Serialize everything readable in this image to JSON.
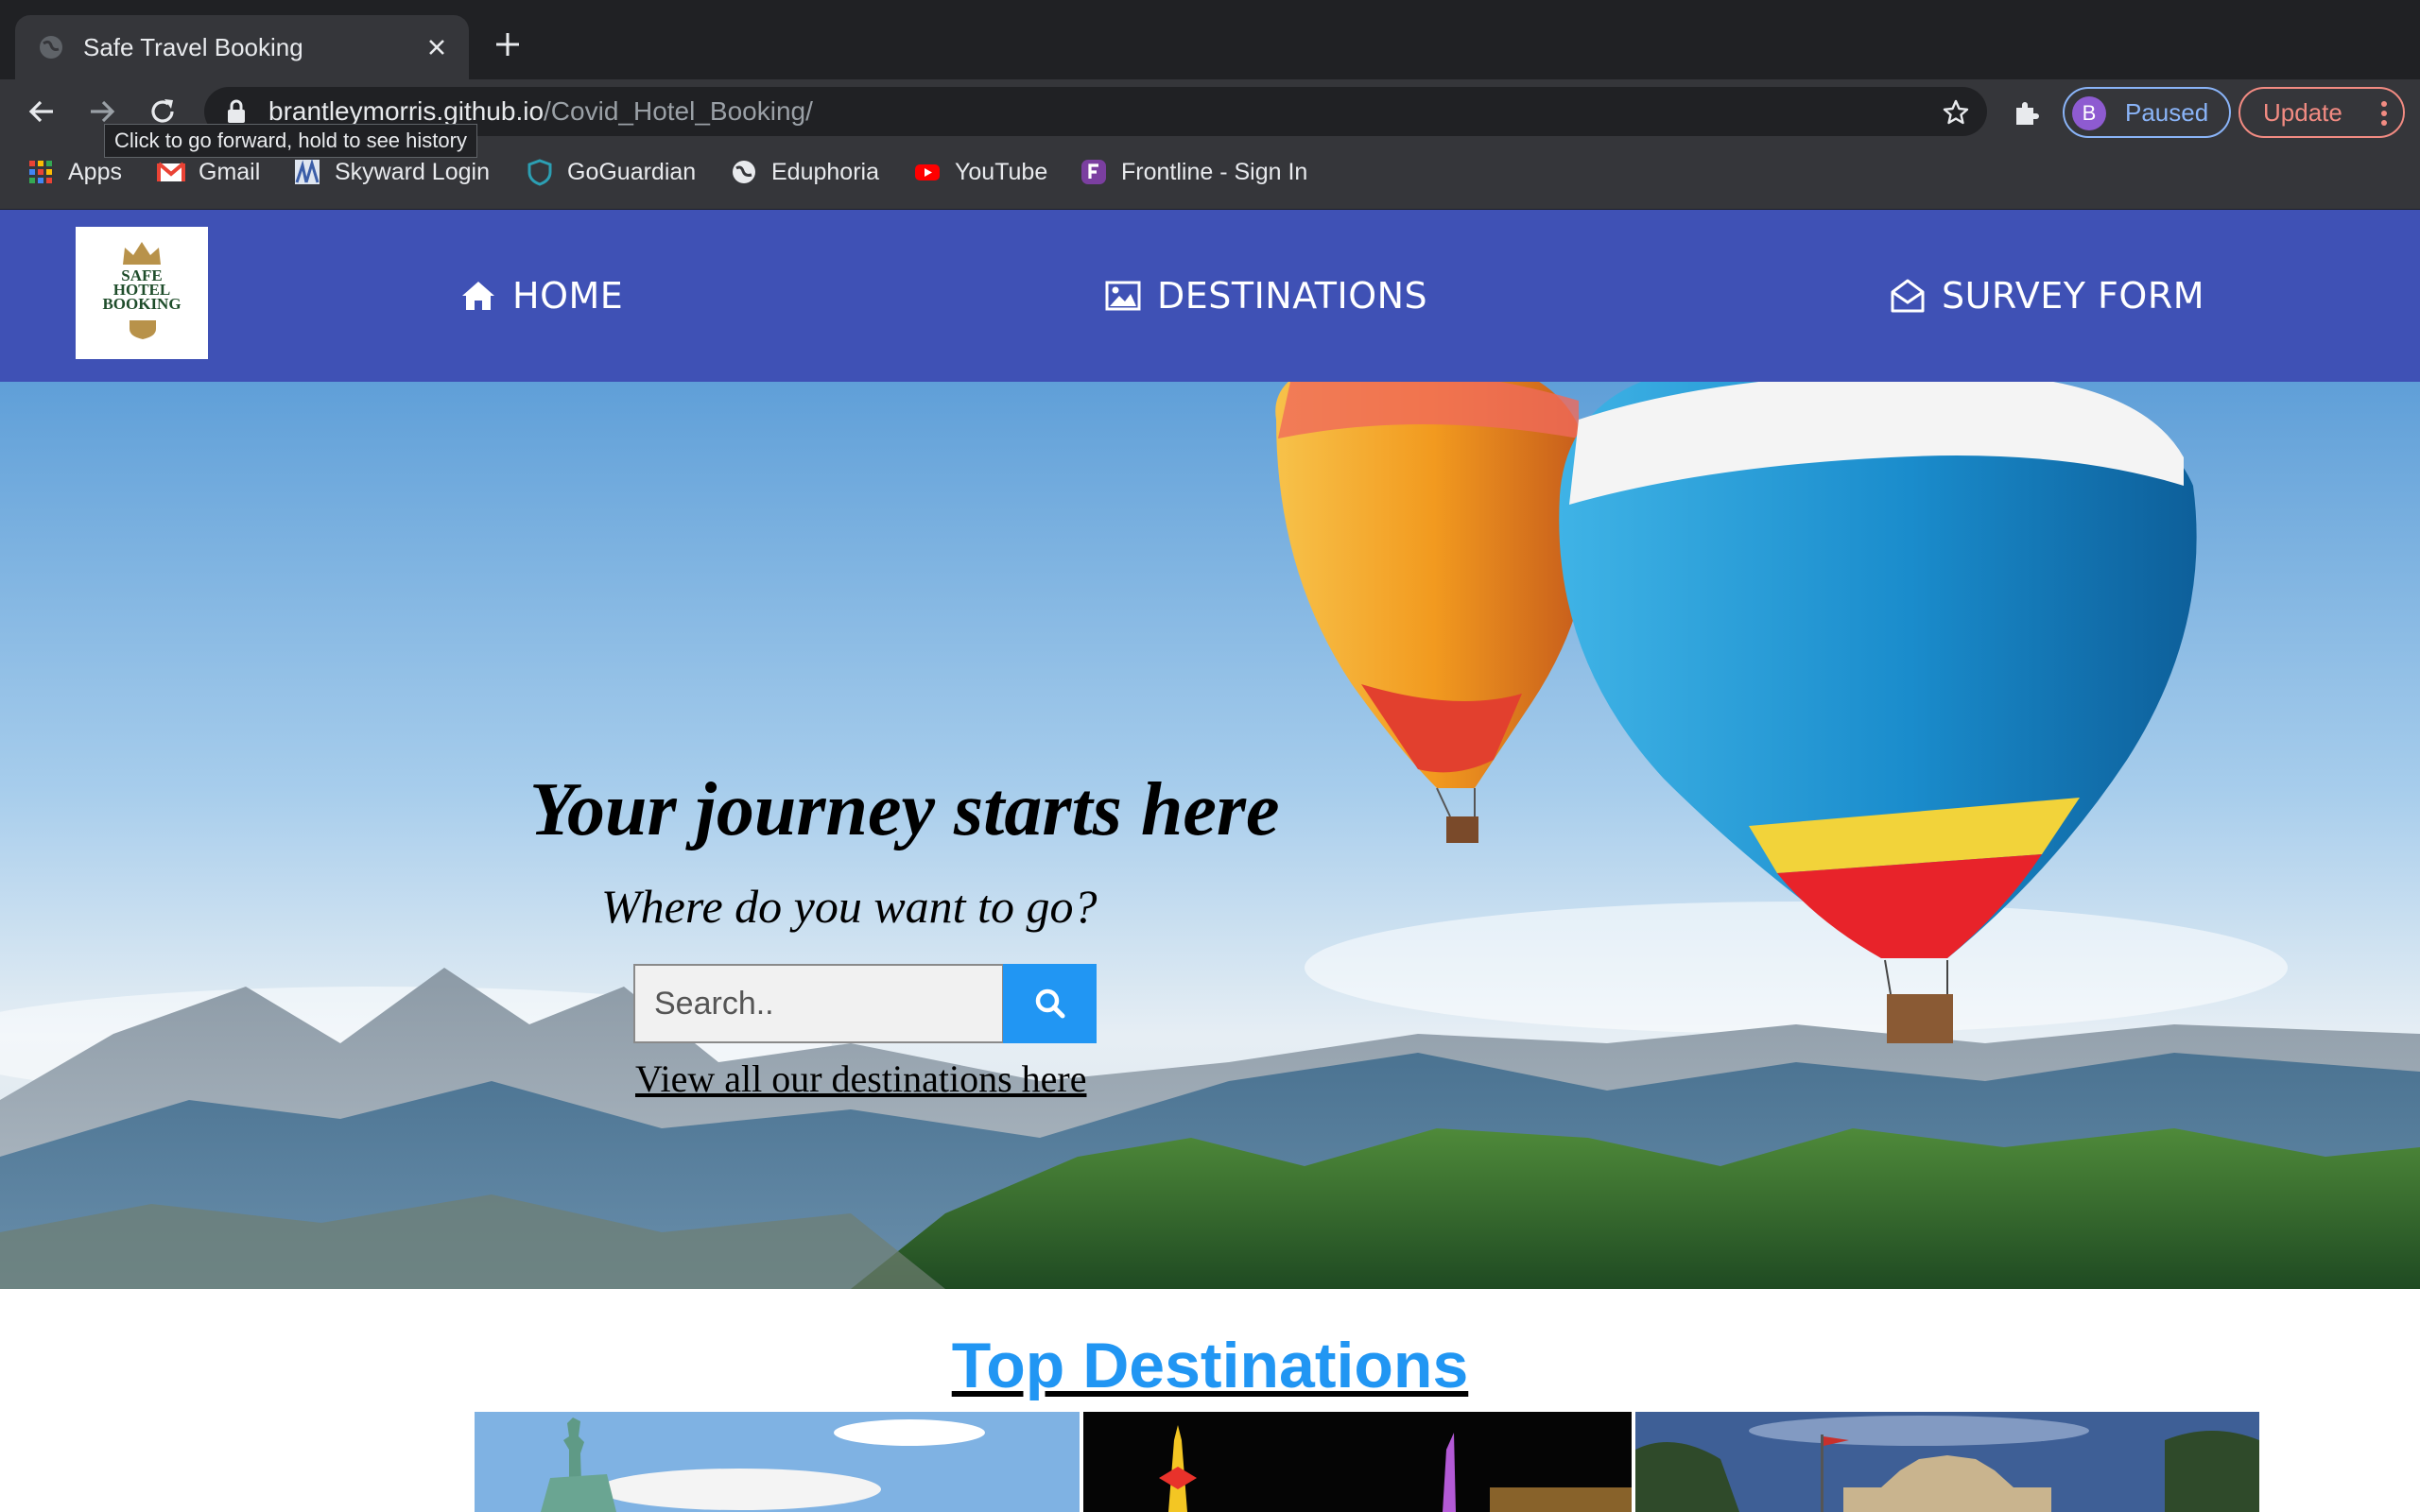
{
  "browser": {
    "tab": {
      "title": "Safe Travel Booking"
    },
    "address": {
      "host": "brantleymorris.github.io",
      "path": "/Covid_Hotel_Booking/"
    },
    "tooltip": "Click to go forward, hold to see history",
    "profile": {
      "initial": "B",
      "label": "Paused"
    },
    "update_label": "Update",
    "bookmarks": [
      {
        "label": "Apps",
        "icon": "apps-grid-icon"
      },
      {
        "label": "Gmail",
        "icon": "gmail-icon"
      },
      {
        "label": "Skyward Login",
        "icon": "skyward-icon"
      },
      {
        "label": "GoGuardian",
        "icon": "goguardian-shield-icon"
      },
      {
        "label": "Eduphoria",
        "icon": "globe-icon"
      },
      {
        "label": "YouTube",
        "icon": "youtube-icon"
      },
      {
        "label": "Frontline - Sign In",
        "icon": "frontline-icon"
      }
    ]
  },
  "site": {
    "logo_text": "SAFE\nHOTEL\nBOOKING",
    "nav": [
      {
        "label": "HOME",
        "icon": "home-icon"
      },
      {
        "label": "DESTINATIONS",
        "icon": "image-icon"
      },
      {
        "label": "SURVEY FORM",
        "icon": "envelope-open-icon"
      }
    ],
    "hero": {
      "title": "Your journey starts here",
      "subtitle": "Where do you want to go?",
      "search_placeholder": "Search..",
      "view_all_link": "View all our destinations here"
    },
    "top_destinations": {
      "title": "Top Destinations"
    }
  },
  "colors": {
    "nav_bg": "#3f51b5",
    "search_button": "#2196f3",
    "section_title": "#2196f3",
    "chrome_dark": "#202124",
    "chrome_toolbar": "#35363a"
  }
}
